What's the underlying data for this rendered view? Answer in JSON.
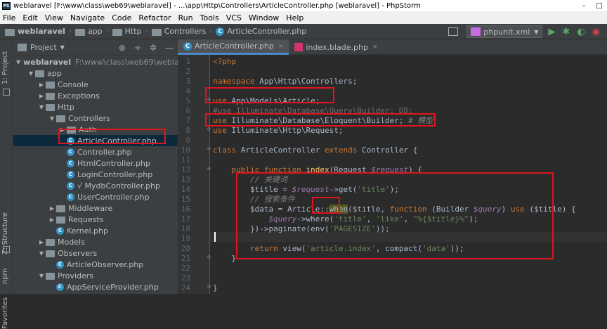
{
  "window": {
    "title": "weblaravel [F:\\www\\class\\web69\\weblaravel] - ...\\app\\Http\\Controllers\\ArticleController.php [weblaravel] - PhpStorm",
    "minimize": "–",
    "maximize": "□"
  },
  "menu": [
    "File",
    "Edit",
    "View",
    "Navigate",
    "Code",
    "Refactor",
    "Run",
    "Tools",
    "VCS",
    "Window",
    "Help"
  ],
  "breadcrumb": {
    "project": "weblaravel",
    "parts": [
      "app",
      "Http",
      "Controllers"
    ],
    "file": "ArticleController.php"
  },
  "run_config": "phpunit.xml",
  "stripe": {
    "project_label": "1: Project",
    "structure_label": "Z: Structure",
    "npm_label": "npm",
    "favorites_label": "Favorites"
  },
  "project_panel": {
    "title": "Project",
    "tree": [
      {
        "label": "weblaravel",
        "path": "F:\\www\\class\\web69\\weblaravel",
        "type": "folder",
        "depth": 0,
        "arrow": "▼",
        "bold": true
      },
      {
        "label": "app",
        "type": "folder",
        "depth": 1,
        "arrow": "▼"
      },
      {
        "label": "Console",
        "type": "folder",
        "depth": 2,
        "arrow": "▶"
      },
      {
        "label": "Exceptions",
        "type": "folder",
        "depth": 2,
        "arrow": "▶"
      },
      {
        "label": "Http",
        "type": "folder",
        "depth": 2,
        "arrow": "▼"
      },
      {
        "label": "Controllers",
        "type": "folder",
        "depth": 3,
        "arrow": "▼"
      },
      {
        "label": "Auth",
        "type": "folder",
        "depth": 4,
        "arrow": "▶"
      },
      {
        "label": "ArticleController.php",
        "type": "class",
        "depth": 4,
        "arrow": ""
      },
      {
        "label": "Controller.php",
        "type": "class",
        "depth": 4,
        "arrow": ""
      },
      {
        "label": "HtmlController.php",
        "type": "class",
        "depth": 4,
        "arrow": ""
      },
      {
        "label": "LoginController.php",
        "type": "class",
        "depth": 4,
        "arrow": ""
      },
      {
        "label": "√ MydbController.php",
        "type": "class",
        "depth": 4,
        "arrow": ""
      },
      {
        "label": "UserController.php",
        "type": "class",
        "depth": 4,
        "arrow": ""
      },
      {
        "label": "Middleware",
        "type": "folder",
        "depth": 3,
        "arrow": "▶"
      },
      {
        "label": "Requests",
        "type": "folder",
        "depth": 3,
        "arrow": "▶"
      },
      {
        "label": "Kernel.php",
        "type": "class",
        "depth": 3,
        "arrow": ""
      },
      {
        "label": "Models",
        "type": "folder",
        "depth": 2,
        "arrow": "▶"
      },
      {
        "label": "Observers",
        "type": "folder",
        "depth": 2,
        "arrow": "▼"
      },
      {
        "label": "ArticleObserver.php",
        "type": "class",
        "depth": 3,
        "arrow": ""
      },
      {
        "label": "Providers",
        "type": "folder",
        "depth": 2,
        "arrow": "▼"
      },
      {
        "label": "AppServiceProvider.php",
        "type": "class",
        "depth": 3,
        "arrow": ""
      }
    ]
  },
  "tabs": [
    {
      "label": "ArticleController.php",
      "active": true,
      "icon": "class-icon"
    },
    {
      "label": "index.blade.php",
      "active": false,
      "icon": "blade-icon"
    }
  ],
  "colors": {
    "accent": "#4a88c7",
    "annotation_box": "#e0141e",
    "selection": "#0d293e"
  },
  "editor": {
    "line_numbers": [
      "1",
      "2",
      "3",
      "4",
      "5",
      "6",
      "7",
      "8",
      "9",
      "10",
      "11",
      "12",
      "13",
      "14",
      "15",
      "16",
      "17",
      "18",
      "19",
      "20",
      "21",
      "22",
      "23",
      "24"
    ],
    "current_line": 19,
    "lines": [
      [
        [
          "php-tag",
          "<?php"
        ]
      ],
      [],
      [
        [
          "kw",
          "namespace "
        ],
        [
          "tx",
          "App\\Http\\Controllers;"
        ]
      ],
      [],
      [
        [
          "kw",
          "use "
        ],
        [
          "tx",
          "App\\Models\\Article;"
        ]
      ],
      [
        [
          "unused",
          "#use Illuminate\\Database\\Query\\Builder; DB;"
        ]
      ],
      [
        [
          "kw",
          "use "
        ],
        [
          "tx",
          "Illuminate\\Database\\Eloquent\\Builder; "
        ],
        [
          "cmt",
          "# 模型"
        ]
      ],
      [
        [
          "kw",
          "use "
        ],
        [
          "tx",
          "Illuminate\\Http\\Request;"
        ]
      ],
      [],
      [
        [
          "kw",
          "class "
        ],
        [
          "tx",
          "ArticleController "
        ],
        [
          "kw",
          "extends "
        ],
        [
          "tx",
          "Controller {"
        ]
      ],
      [],
      [
        [
          "tx",
          "    "
        ],
        [
          "kw",
          "public function "
        ],
        [
          "fn",
          "index"
        ],
        [
          "tx",
          "(Request "
        ],
        [
          "var",
          "$request"
        ],
        [
          "tx",
          ") {"
        ]
      ],
      [
        [
          "tx",
          "        "
        ],
        [
          "cmt",
          "// 关键词"
        ]
      ],
      [
        [
          "tx",
          "        $title = "
        ],
        [
          "var",
          "$request"
        ],
        [
          "tx",
          "->get("
        ],
        [
          "str",
          "'title'"
        ],
        [
          "tx",
          ");"
        ]
      ],
      [
        [
          "tx",
          "        "
        ],
        [
          "cmt",
          "// 搜索条件"
        ]
      ],
      [
        [
          "tx",
          "        $data = Article::"
        ],
        [
          "hl",
          "when"
        ],
        [
          "tx",
          "($title, "
        ],
        [
          "kw",
          "function "
        ],
        [
          "tx",
          "(Builder "
        ],
        [
          "var",
          "$query"
        ],
        [
          "tx",
          ") "
        ],
        [
          "kw",
          "use "
        ],
        [
          "tx",
          "($title) {"
        ]
      ],
      [
        [
          "tx",
          "            "
        ],
        [
          "var",
          "$query"
        ],
        [
          "tx",
          "->where("
        ],
        [
          "str",
          "'title'"
        ],
        [
          "tx",
          ", "
        ],
        [
          "str",
          "'like'"
        ],
        [
          "tx",
          ", "
        ],
        [
          "str",
          "\"%{$title}%\""
        ],
        [
          "tx",
          ");"
        ]
      ],
      [
        [
          "tx",
          "        })->paginate(env("
        ],
        [
          "str",
          "'PAGESIZE'"
        ],
        [
          "tx",
          "));"
        ]
      ],
      [],
      [
        [
          "tx",
          "        "
        ],
        [
          "kw",
          "return "
        ],
        [
          "tx",
          "view("
        ],
        [
          "str",
          "'article.index'"
        ],
        [
          "tx",
          ", compact("
        ],
        [
          "str",
          "'data'"
        ],
        [
          "tx",
          "));"
        ]
      ],
      [
        [
          "tx",
          "    }"
        ]
      ],
      [],
      [],
      [
        [
          "tx",
          "}"
        ]
      ]
    ]
  }
}
